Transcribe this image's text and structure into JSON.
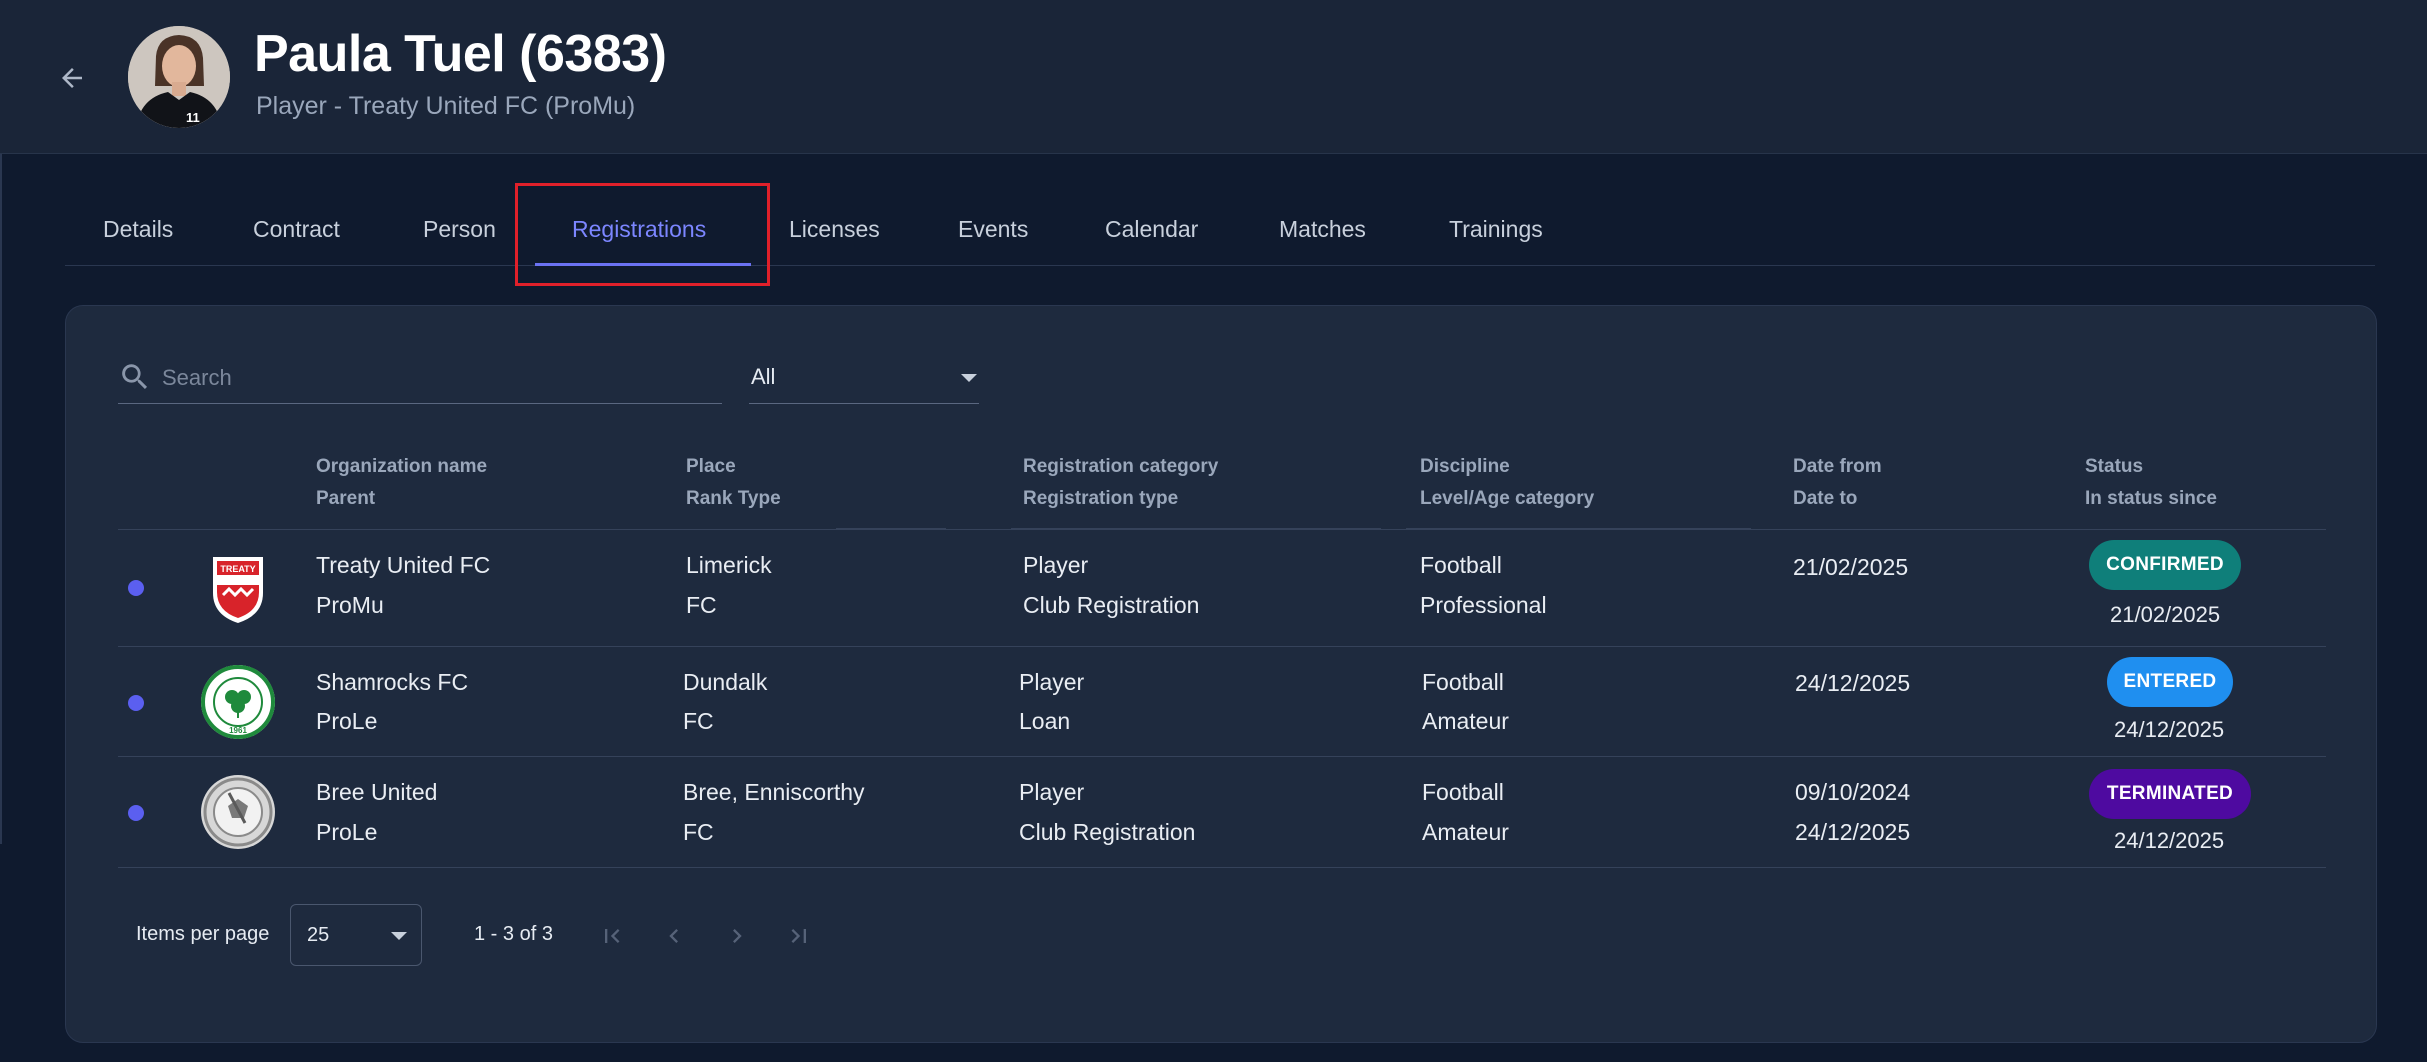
{
  "header": {
    "name": "Paula Tuel (6383)",
    "subtitle": "Player - Treaty United FC (ProMu)",
    "avatar_jersey_number": "11"
  },
  "tabs": [
    {
      "label": "Details",
      "active": false
    },
    {
      "label": "Contract",
      "active": false
    },
    {
      "label": "Person",
      "active": false
    },
    {
      "label": "Registrations",
      "active": true
    },
    {
      "label": "Licenses",
      "active": false
    },
    {
      "label": "Events",
      "active": false
    },
    {
      "label": "Calendar",
      "active": false
    },
    {
      "label": "Matches",
      "active": false
    },
    {
      "label": "Trainings",
      "active": false
    }
  ],
  "filters": {
    "search_placeholder": "Search",
    "status_filter": "All"
  },
  "table": {
    "headers": {
      "org_name": "Organization name",
      "parent": "Parent",
      "place": "Place",
      "rank_type": "Rank Type",
      "reg_category": "Registration category",
      "reg_type": "Registration type",
      "discipline": "Discipline",
      "level": "Level/Age category",
      "date_from": "Date from",
      "date_to": "Date to",
      "status": "Status",
      "status_since": "In status since"
    },
    "rows": [
      {
        "logo": "treaty-united-crest",
        "logo_text": "TREATY",
        "org_name": "Treaty United FC",
        "parent": "ProMu",
        "place": "Limerick",
        "rank_type": "FC",
        "reg_category": "Player",
        "reg_type": "Club Registration",
        "discipline": "Football",
        "level": "Professional",
        "date_from": "21/02/2025",
        "date_to": "",
        "status": "CONFIRMED",
        "status_color": "#0f7f7a",
        "status_since": "21/02/2025"
      },
      {
        "logo": "shamrocks-crest",
        "logo_text": "1961",
        "org_name": "Shamrocks FC",
        "parent": "ProLe",
        "place": "Dundalk",
        "rank_type": "FC",
        "reg_category": "Player",
        "reg_type": "Loan",
        "discipline": "Football",
        "level": "Amateur",
        "date_from": "24/12/2025",
        "date_to": "",
        "status": "ENTERED",
        "status_color": "#1f8ff0",
        "status_since": "24/12/2025"
      },
      {
        "logo": "bree-united-crest",
        "logo_text": "",
        "org_name": "Bree United",
        "parent": "ProLe",
        "place": "Bree, Enniscorthy",
        "rank_type": "FC",
        "reg_category": "Player",
        "reg_type": "Club Registration",
        "discipline": "Football",
        "level": "Amateur",
        "date_from": "09/10/2024",
        "date_to": "24/12/2025",
        "status": "TERMINATED",
        "status_color": "#4e0aa0",
        "status_since": "24/12/2025"
      }
    ]
  },
  "paginator": {
    "items_per_page_label": "Items per page",
    "items_per_page": "25",
    "range_label": "1 - 3 of 3"
  },
  "colors": {
    "accent": "#7c86ff",
    "highlight_box": "#e0202a",
    "row_dot": "#5b5ff0"
  }
}
